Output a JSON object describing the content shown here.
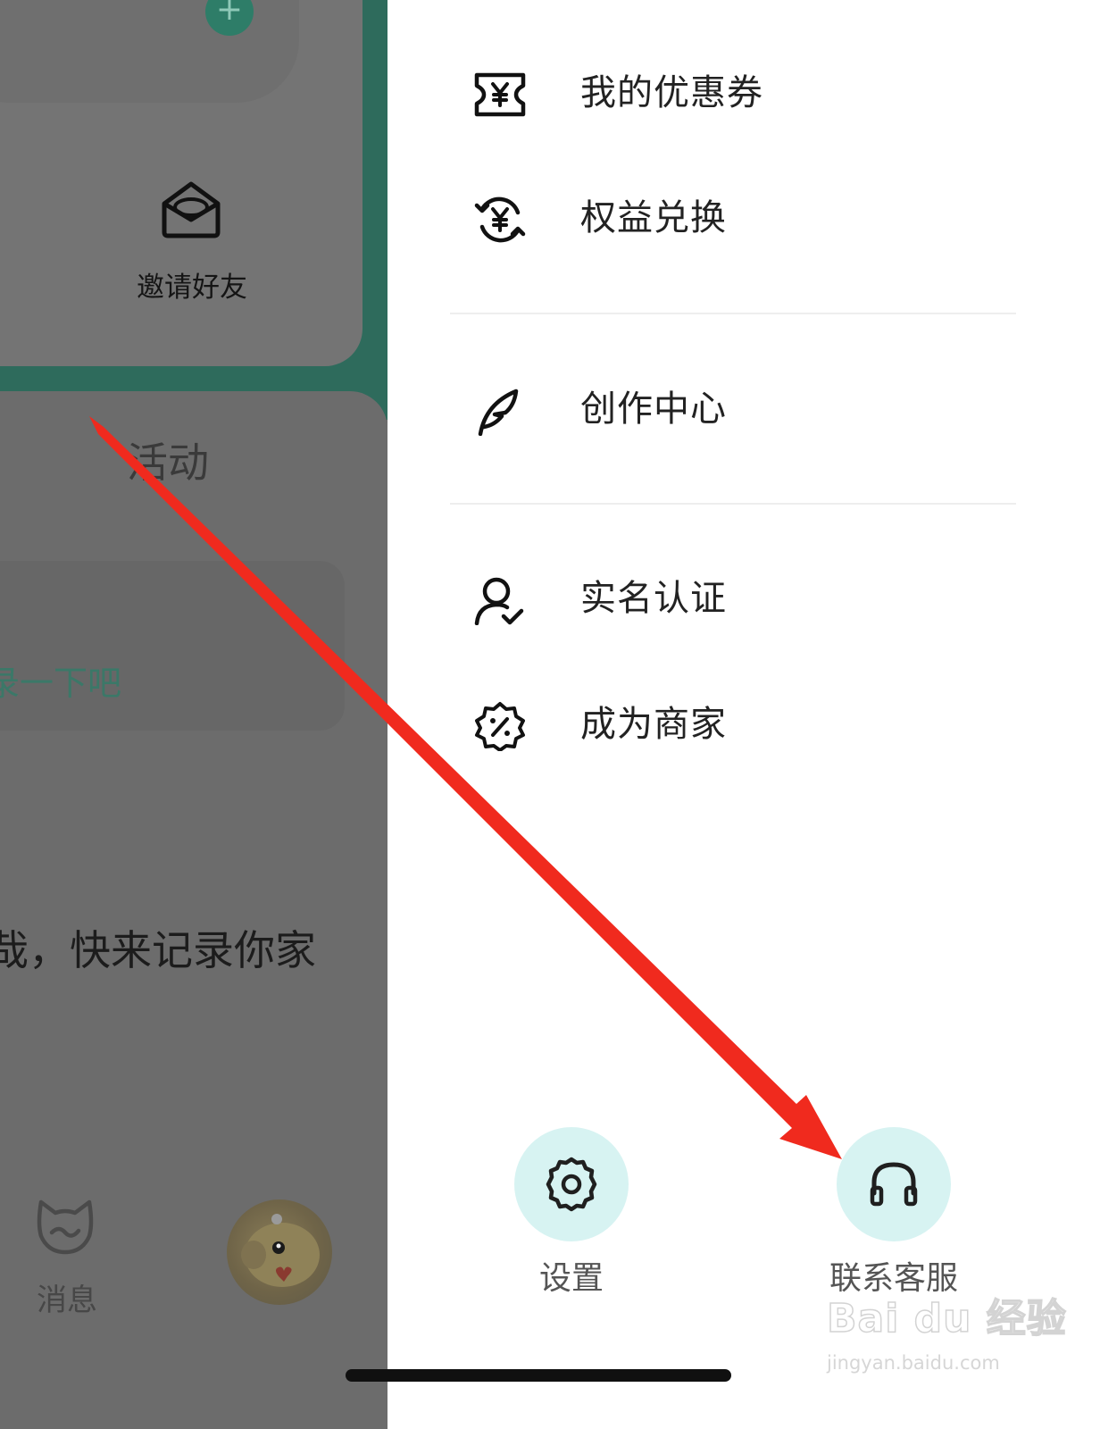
{
  "left_panel": {
    "invite_friends": "邀请好友",
    "activity_title": "活动",
    "activity_link": "录一下吧",
    "feed_text": "哉，快来记录你家",
    "nav_message": "消息"
  },
  "drawer": {
    "menu_items": [
      {
        "label": "我的优惠券",
        "icon": "coupon-yen-icon"
      },
      {
        "label": "权益兑换",
        "icon": "yen-exchange-icon"
      },
      {
        "label": "创作中心",
        "icon": "feather-icon"
      },
      {
        "label": "实名认证",
        "icon": "user-check-icon"
      },
      {
        "label": "成为商家",
        "icon": "discount-badge-icon"
      }
    ],
    "bottom_buttons": [
      {
        "label": "设置",
        "icon": "gear-icon"
      },
      {
        "label": "联系客服",
        "icon": "headphones-icon"
      }
    ]
  },
  "watermark": {
    "brand": "Bai du 经验",
    "url": "jingyan.baidu.com"
  },
  "colors": {
    "accent_teal": "#2e6b5c",
    "bottom_circle": "#d7f3f2",
    "annotation_arrow": "#f02a1e"
  }
}
